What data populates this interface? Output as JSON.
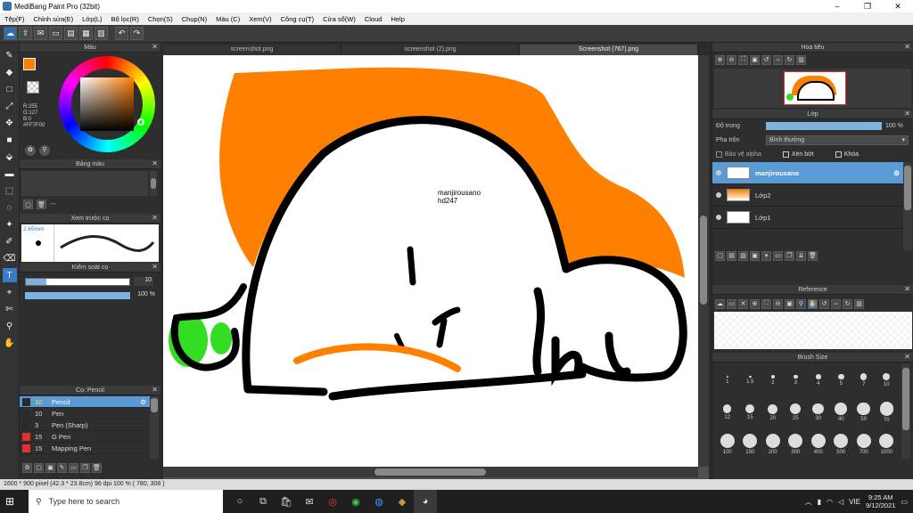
{
  "window": {
    "title": "MediBang Paint Pro (32bit)",
    "minimize": "–",
    "maximize": "❐",
    "close": "✕"
  },
  "menu": [
    "Tệp(F)",
    "Chỉnh sửa(E)",
    "Lớp(L)",
    "Bộ lọc(R)",
    "Chọn(S)",
    "Chụp(N)",
    "Màu (C)",
    "Xem(V)",
    "Công cụ(T)",
    "Cửa sổ(W)",
    "Cloud",
    "Help"
  ],
  "tabs": [
    {
      "label": "screenshot.png",
      "active": false
    },
    {
      "label": "screenshot (2).png",
      "active": false
    },
    {
      "label": "Screenshot (767).png",
      "active": true
    }
  ],
  "color_panel": {
    "title": "Màu",
    "r": "R:255",
    "g": "G:127",
    "b": "B:0",
    "hex": "#FF7F00",
    "primary_color": "#FF7F00"
  },
  "palette_panel": {
    "title": "Bảng màu",
    "placeholder": "---"
  },
  "brush_preview": {
    "title": "Xem trước cọ",
    "size": "2.65mm"
  },
  "brush_control": {
    "title": "Kiểm soát cọ",
    "size_value": "10",
    "opacity_value": "100 %",
    "size_fraction": 0.2,
    "opacity_fraction": 1.0
  },
  "brush_list": {
    "title": "Cọ: Pencil",
    "items": [
      {
        "size": "10",
        "name": "Pencil",
        "color": "#2a2a2a",
        "selected": true
      },
      {
        "size": "10",
        "name": "Pen",
        "color": "#2a2a2a",
        "selected": false
      },
      {
        "size": "3",
        "name": "Pen (Sharp)",
        "color": "#2a2a2a",
        "selected": false
      },
      {
        "size": "15",
        "name": "G Pen",
        "color": "#e03030",
        "selected": false
      },
      {
        "size": "15",
        "name": "Mapping Pen",
        "color": "#e03030",
        "selected": false
      }
    ]
  },
  "navigator": {
    "title": "Hoa tiêu"
  },
  "layer_panel": {
    "title": "Lớp",
    "opacity_label": "Độ trong",
    "opacity_value": "100 %",
    "opacity_fraction": 1.0,
    "blend_label": "Pha trộn",
    "blend_value": "Bình thường",
    "protect_alpha": "Bảo vệ alpha",
    "clipping": "Xén bớt",
    "lock": "Khóa",
    "layers": [
      {
        "name": "manjirousano",
        "selected": true
      },
      {
        "name": "Lớp2",
        "selected": false
      },
      {
        "name": "Lớp1",
        "selected": false
      }
    ]
  },
  "reference_panel": {
    "title": "Reference"
  },
  "brush_size_panel": {
    "title": "Brush Size",
    "sizes": [
      "1",
      "1.5",
      "2",
      "3",
      "4",
      "5",
      "7",
      "10",
      "12",
      "15",
      "20",
      "25",
      "30",
      "40",
      "50",
      "70",
      "100",
      "150",
      "200",
      "300",
      "400",
      "500",
      "700",
      "1000"
    ]
  },
  "canvas_text": {
    "line1": "manjirousano",
    "line2": "hd247"
  },
  "status": "1600 * 900 pixel  (42.3 * 23.8cm)  96 dpi  100 %  ( 780, 308 )",
  "taskbar": {
    "search_placeholder": "Type here to search",
    "time": "9:25 AM",
    "date": "9/12/2021",
    "lang": "VIE"
  },
  "colors": {
    "accent": "#5a9bd5",
    "orange": "#FF7F00",
    "green": "#33dd22"
  }
}
